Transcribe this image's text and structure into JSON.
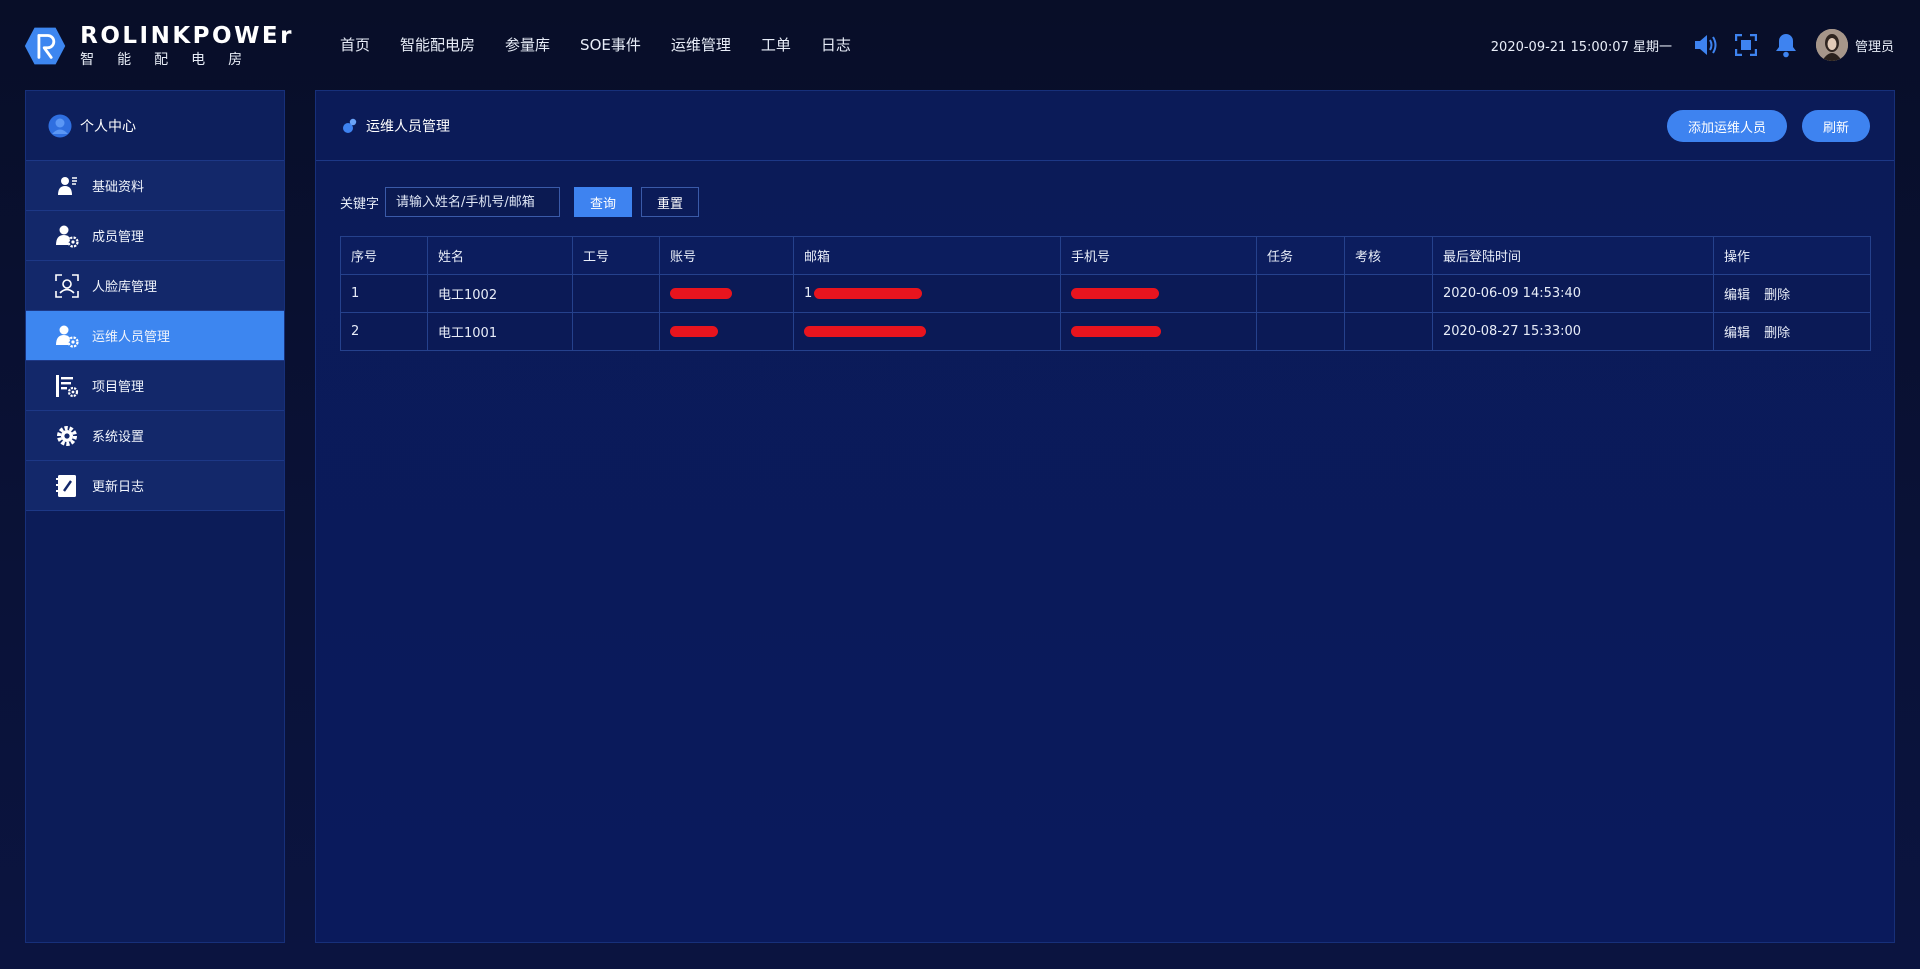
{
  "header": {
    "brand": "ROLINKPOWEr",
    "brand_sub": "智能配电房",
    "nav": [
      "首页",
      "智能配电房",
      "参量库",
      "SOE事件",
      "运维管理",
      "工单",
      "日志"
    ],
    "datetime": "2020-09-21 15:00:07 星期一",
    "user_name": "管理员"
  },
  "sidebar": {
    "title": "个人中心",
    "items": [
      {
        "label": "基础资料",
        "icon": "user-card-icon"
      },
      {
        "label": "成员管理",
        "icon": "user-gear-icon"
      },
      {
        "label": "人脸库管理",
        "icon": "face-scan-icon"
      },
      {
        "label": "运维人员管理",
        "icon": "user-gear-icon",
        "active": true
      },
      {
        "label": "项目管理",
        "icon": "list-gear-icon"
      },
      {
        "label": "系统设置",
        "icon": "gear-icon"
      },
      {
        "label": "更新日志",
        "icon": "notebook-icon"
      }
    ]
  },
  "main": {
    "title": "运维人员管理",
    "add_button": "添加运维人员",
    "refresh_button": "刷新",
    "search": {
      "label": "关键字",
      "placeholder": "请输入姓名/手机号/邮箱",
      "query_button": "查询",
      "reset_button": "重置"
    },
    "table": {
      "columns": [
        "序号",
        "姓名",
        "工号",
        "账号",
        "邮箱",
        "手机号",
        "任务",
        "考核",
        "最后登陆时间",
        "操作"
      ],
      "rows": [
        {
          "index": "1",
          "name": "电工1002",
          "employee_id": "",
          "email_prefix": "1",
          "tasks": "",
          "assessment": "",
          "last_login": "2020-06-09 14:53:40"
        },
        {
          "index": "2",
          "name": "电工1001",
          "employee_id": "",
          "email_prefix": "",
          "tasks": "",
          "assessment": "",
          "last_login": "2020-08-27 15:33:00"
        }
      ],
      "edit_label": "编辑",
      "delete_label": "删除"
    }
  },
  "colors": {
    "accent": "#3e83f0",
    "background": "#0b1232",
    "panel": "#0b1b58",
    "redaction": "#e8141e"
  }
}
